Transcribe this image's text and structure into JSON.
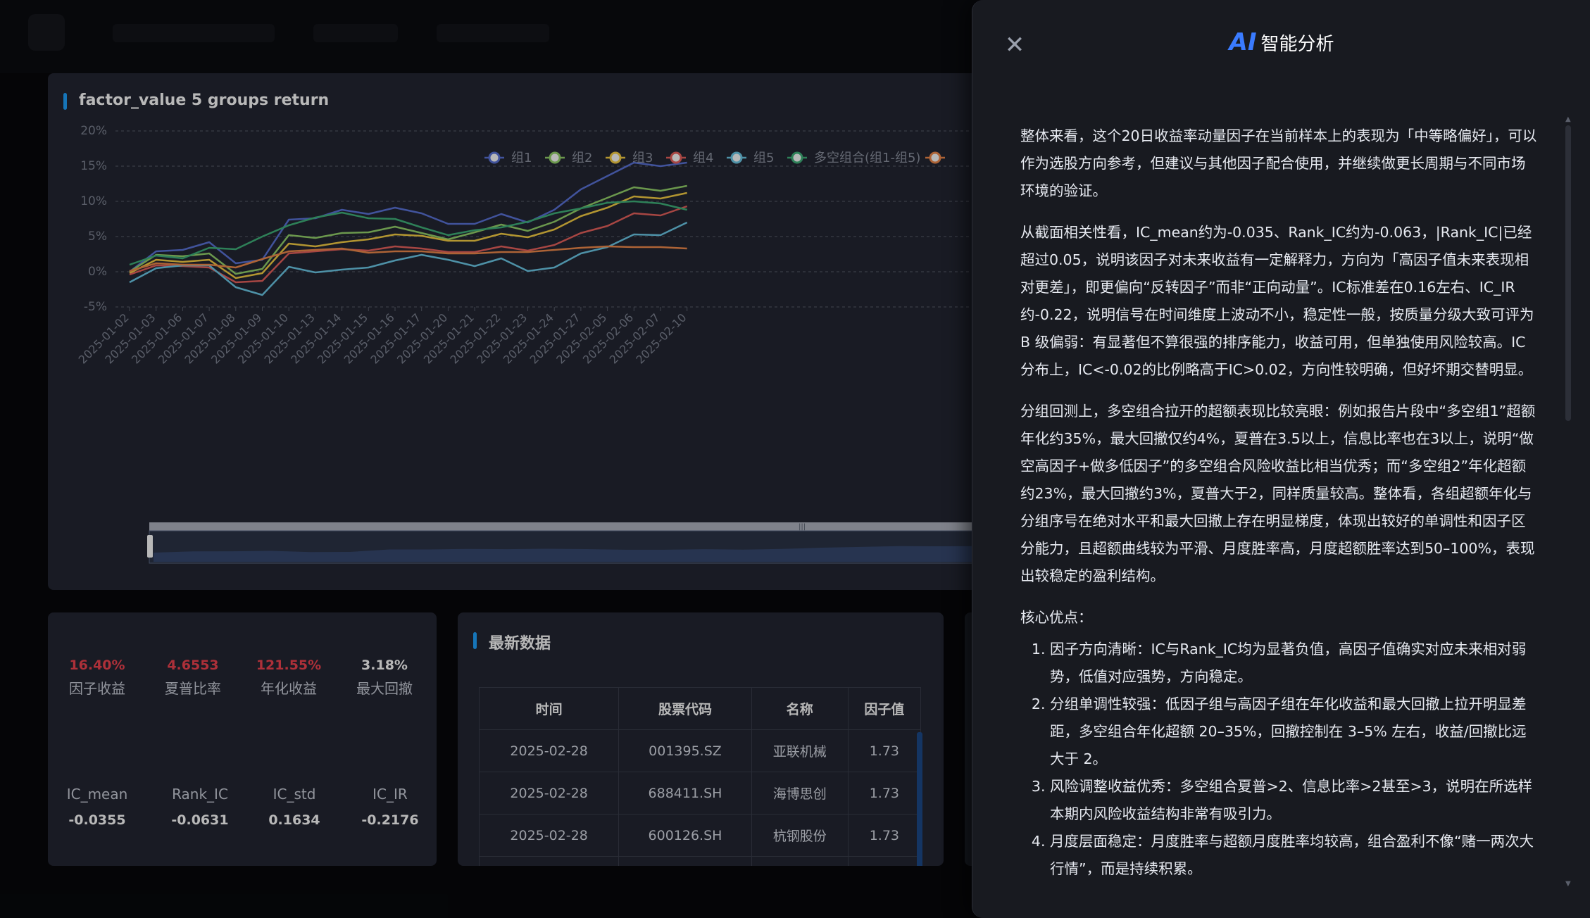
{
  "chart_card": {
    "title": "factor_value 5 groups return"
  },
  "chart_data": {
    "type": "line",
    "title": "factor_value 5 groups return",
    "x": [
      "2025-01-02",
      "2025-01-03",
      "2025-01-06",
      "2025-01-07",
      "2025-01-08",
      "2025-01-09",
      "2025-01-10",
      "2025-01-13",
      "2025-01-14",
      "2025-01-15",
      "2025-01-16",
      "2025-01-17",
      "2025-01-20",
      "2025-01-21",
      "2025-01-22",
      "2025-01-23",
      "2025-01-24",
      "2025-01-27",
      "2025-02-05",
      "2025-02-06",
      "2025-02-07",
      "2025-02-10"
    ],
    "y_ticks": [
      "20%",
      "15%",
      "10%",
      "5%",
      "0%",
      "-5%"
    ],
    "ylim": [
      -5,
      20
    ],
    "grid": true,
    "legend_position": "top",
    "series": [
      {
        "name": "组1",
        "color": "#5b73d8",
        "values": [
          0,
          2.9,
          3.1,
          4.2,
          1.2,
          1.7,
          7.4,
          7.6,
          8.8,
          8.2,
          9.1,
          8.3,
          6.8,
          6.8,
          8.2,
          7.0,
          8.8,
          11.7,
          13.6,
          15.5,
          15.0,
          15.5
        ]
      },
      {
        "name": "组2",
        "color": "#95d36b",
        "values": [
          0,
          2.4,
          2.2,
          2.6,
          -0.3,
          0.4,
          5.2,
          4.8,
          5.5,
          5.6,
          6.4,
          5.5,
          4.6,
          5.6,
          6.7,
          5.8,
          7.1,
          9.0,
          10.5,
          12.0,
          11.5,
          12.2
        ]
      },
      {
        "name": "组3",
        "color": "#f7cf45",
        "values": [
          -0.2,
          1.7,
          1.4,
          1.7,
          -0.9,
          -0.2,
          4.0,
          3.6,
          4.2,
          4.6,
          5.3,
          5.1,
          4.4,
          4.4,
          5.4,
          4.9,
          6.0,
          7.9,
          9.1,
          10.7,
          10.4,
          11.2
        ]
      },
      {
        "name": "组4",
        "color": "#e8625d",
        "values": [
          -0.4,
          0.9,
          0.8,
          0.6,
          -1.5,
          -1.3,
          2.6,
          2.9,
          3.2,
          3.0,
          3.6,
          3.3,
          2.8,
          2.8,
          3.6,
          3.0,
          3.8,
          5.5,
          6.5,
          8.3,
          8.0,
          9.3
        ]
      },
      {
        "name": "组5",
        "color": "#6cc9e8",
        "values": [
          -1.5,
          0.5,
          0.9,
          0.9,
          -2.2,
          -3.3,
          0.7,
          -0.1,
          0.3,
          0.6,
          1.6,
          2.4,
          1.7,
          0.8,
          1.9,
          0.1,
          0.6,
          2.6,
          3.5,
          5.3,
          5.2,
          7.0
        ]
      },
      {
        "name": "多空组合(组1-组5)",
        "color": "#40b27a",
        "values": [
          1.0,
          2.3,
          1.9,
          3.4,
          3.2,
          5.0,
          6.6,
          7.7,
          8.4,
          7.6,
          7.5,
          6.3,
          5.2,
          5.9,
          6.3,
          7.1,
          8.3,
          9.0,
          9.8,
          10.0,
          9.7,
          8.8
        ]
      },
      {
        "name": "",
        "color": "#f08a4b",
        "values": [
          0.1,
          1.2,
          1.0,
          1.0,
          0.6,
          1.8,
          2.9,
          3.1,
          3.3,
          2.7,
          2.9,
          2.9,
          2.6,
          2.6,
          2.8,
          2.8,
          3.1,
          3.4,
          3.6,
          3.5,
          3.5,
          3.3
        ]
      }
    ]
  },
  "metrics": {
    "row1": [
      {
        "value": "16.40%",
        "label": "因子收益",
        "color": "#f0434f"
      },
      {
        "value": "4.6553",
        "label": "夏普比率",
        "color": "#f0434f"
      },
      {
        "value": "121.55%",
        "label": "年化收益",
        "color": "#f0434f"
      },
      {
        "value": "3.18%",
        "label": "最大回撤",
        "color": "#ffffff"
      }
    ],
    "row2": [
      {
        "label": "IC_mean",
        "value": "-0.0355"
      },
      {
        "label": "Rank_IC",
        "value": "-0.0631"
      },
      {
        "label": "IC_std",
        "value": "0.1634"
      },
      {
        "label": "IC_IR",
        "value": "-0.2176"
      }
    ]
  },
  "latest": {
    "title": "最新数据",
    "headers": [
      "时间",
      "股票代码",
      "名称",
      "因子值"
    ],
    "rows": [
      [
        "2025-02-28",
        "001395.SZ",
        "亚联机械",
        "1.73"
      ],
      [
        "2025-02-28",
        "688411.SH",
        "海博思创",
        "1.73"
      ],
      [
        "2025-02-28",
        "600126.SH",
        "杭钢股份",
        "1.73"
      ]
    ]
  },
  "drawer": {
    "ai_mark": "AI",
    "title": "智能分析",
    "close_icon": "close-icon",
    "p1": "整体来看，这个20日收益率动量因子在当前样本上的表现为「中等略偏好」，可以作为选股方向参考，但建议与其他因子配合使用，并继续做更长周期与不同市场环境的验证。",
    "p2": "从截面相关性看，IC_mean约为-0.035、Rank_IC约为-0.063，|Rank_IC|已经超过0.05，说明该因子对未来收益有一定解释力，方向为「高因子值未来表现相对更差」，即更偏向“反转因子”而非“正向动量”。IC标准差在0.16左右、IC_IR约-0.22，说明信号在时间维度上波动不小，稳定性一般，按质量分级大致可评为 B 级偏弱：有显著但不算很强的排序能力，收益可用，但单独使用风险较高。IC分布上，IC<-0.02的比例略高于IC>0.02，方向性较明确，但好坏期交替明显。",
    "p3": "分组回测上，多空组合拉开的超额表现比较亮眼：例如报告片段中“多空组1”超额年化约35%，最大回撤仅约4%，夏普在3.5以上，信息比率也在3以上，说明“做空高因子+做多低因子”的多空组合风险收益比相当优秀；而“多空组2”年化超额约23%，最大回撤约3%，夏普大于2，同样质量较高。整体看，各组超额年化与分组序号在绝对水平和最大回撤上存在明显梯度，体现出较好的单调性和因子区分能力，且超额曲线较为平滑、月度胜率高，月度超额胜率达到50–100%，表现出较稳定的盈利结构。",
    "p4": "核心优点：",
    "list": [
      "因子方向清晰：IC与Rank_IC均为显著负值，高因子值确实对应未来相对弱势，低值对应强势，方向稳定。",
      "分组单调性较强：低因子组与高因子组在年化收益和最大回撤上拉开明显差距，多空组合年化超额 20–35%，回撤控制在 3–5% 左右，收益/回撤比远大于 2。",
      "风险调整收益优秀：多空组合夏普>2、信息比率>2甚至>3，说明在所选样本期内风险收益结构非常有吸引力。",
      "月度层面稳定：月度胜率与超额月度胜率均较高，组合盈利不像“赌一两次大行情”，而是持续积累。"
    ]
  }
}
